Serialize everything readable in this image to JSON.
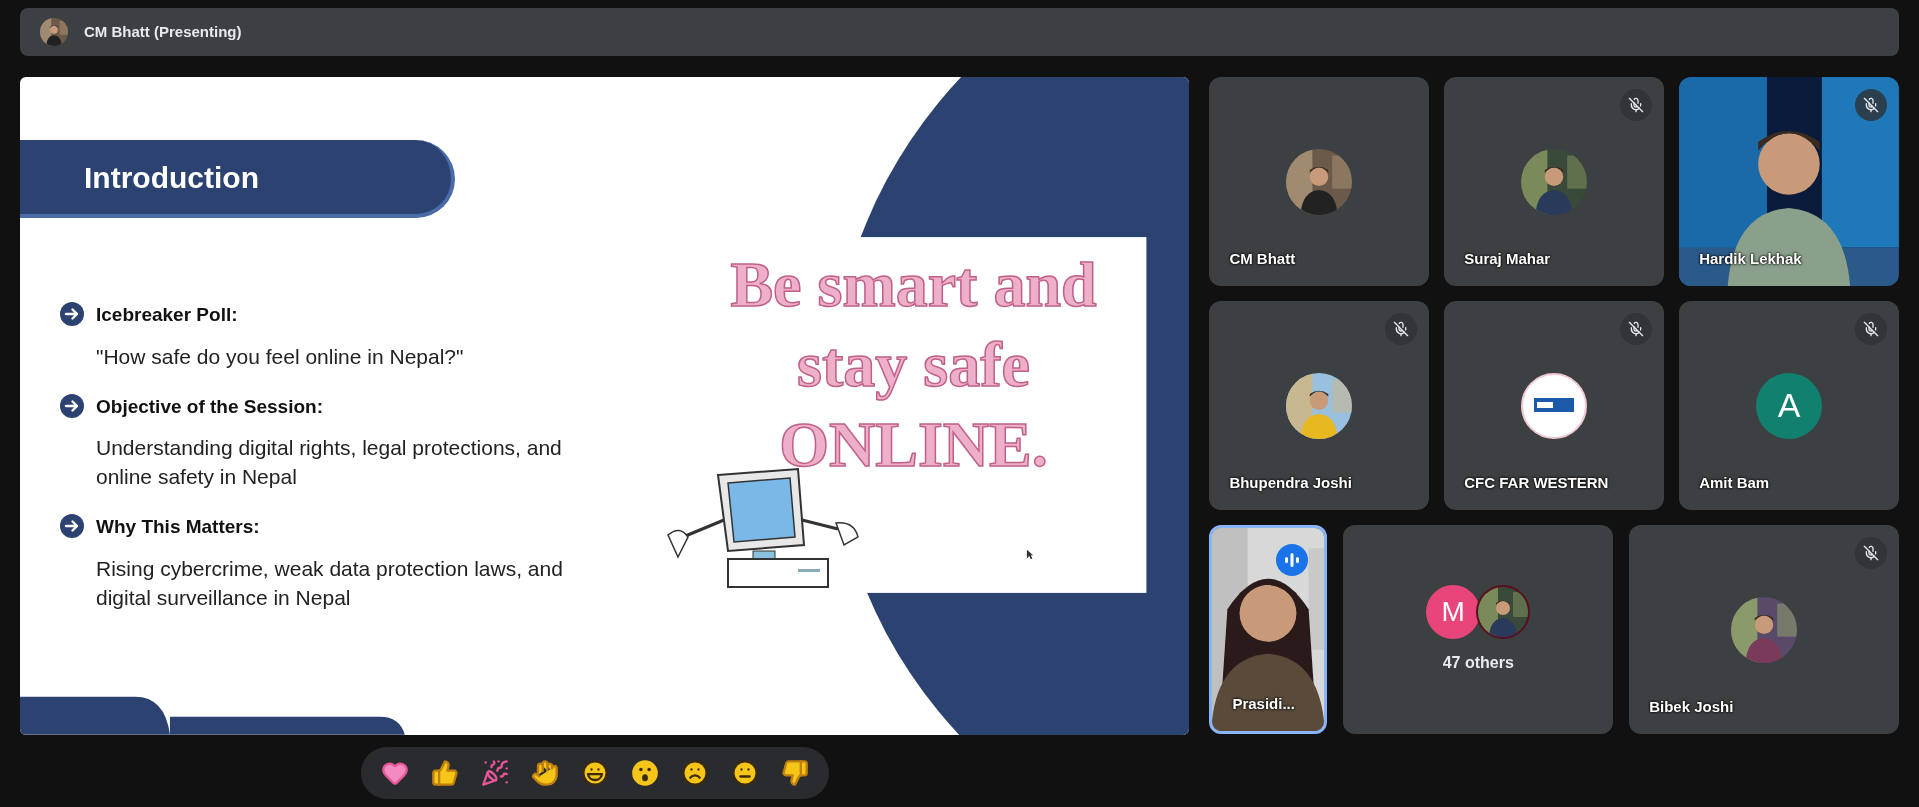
{
  "presenter_bar": {
    "label": "CM Bhatt (Presenting)"
  },
  "slide": {
    "title": "Introduction",
    "points": [
      {
        "heading": "Icebreaker Poll:",
        "body": "\"How safe do you feel online in Nepal?\""
      },
      {
        "heading": "Objective of the Session:",
        "body": "Understanding digital rights, legal protections, and online safety in Nepal"
      },
      {
        "heading": "Why This Matters:",
        "body": "Rising cybercrime, weak data protection laws, and digital surveillance in Nepal"
      }
    ],
    "tagline": [
      "Be smart and",
      "stay safe",
      "ONLINE."
    ]
  },
  "tiles": [
    {
      "name": "CM Bhatt",
      "muted": false,
      "speaking": false
    },
    {
      "name": "Suraj Mahar",
      "muted": true,
      "speaking": false
    },
    {
      "name": "Hardik Lekhak",
      "kind": "video",
      "muted": true,
      "speaking": false
    },
    {
      "name": "Bhupendra Joshi",
      "muted": true,
      "speaking": false
    },
    {
      "name": "CFC FAR WESTERN",
      "kind": "logo",
      "muted": true,
      "speaking": false
    },
    {
      "name": "Amit Bam",
      "kind": "letter",
      "letter": "A",
      "color": "#12806f",
      "muted": true,
      "speaking": false
    },
    {
      "name": "Prasidi...",
      "kind": "video",
      "muted": false,
      "speaking": true
    },
    {
      "name": "47 others",
      "kind": "group",
      "letter": "M",
      "color": "#e8457a",
      "muted": false,
      "speaking": false
    },
    {
      "name": "Bibek Joshi",
      "muted": true,
      "speaking": false
    }
  ]
}
